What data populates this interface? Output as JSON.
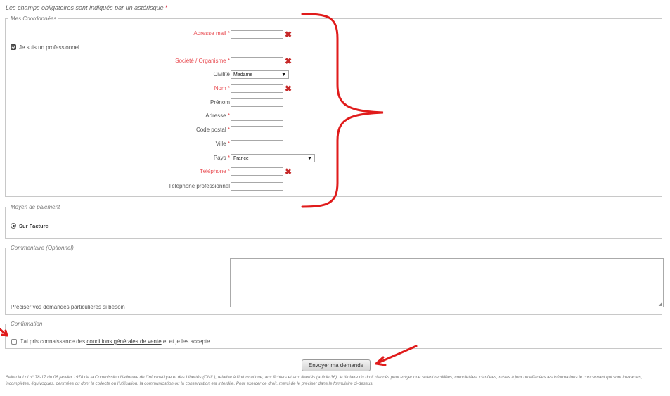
{
  "intro": {
    "text": "Les champs obligatoires sont indiqués par un astérisque",
    "star": "*"
  },
  "coords": {
    "legend": "Mes Coordonnées",
    "pro_checkbox_label": "Je suis un professionnel",
    "pro_checked": true,
    "email_label": "Adresse mail",
    "company_label": "Société / Organisme",
    "civility_label": "Civilité",
    "civility_value": "Madame",
    "lastname_label": "Nom",
    "firstname_label": "Prénom",
    "address_label": "Adresse",
    "zip_label": "Code postal",
    "city_label": "Ville",
    "country_label": "Pays",
    "country_value": "France",
    "phone_label": "Téléphone",
    "phone_pro_label": "Téléphone professionnel",
    "star": "*"
  },
  "payment": {
    "legend": "Moyen de paiement",
    "option": "Sur Facture"
  },
  "comment": {
    "legend": "Commentaire (Optionnel)",
    "hint": "Préciser vos demandes particulières si besoin"
  },
  "confirm": {
    "legend": "Confirmation",
    "text_before": "J'ai pris connaissance des",
    "link": "conditions générales de vente",
    "text_after": "et et je les accepte"
  },
  "submit_label": "Envoyer ma demande",
  "legal_text": "Selon la Loi n° 78-17 du 06 janvier 1978 de la Commission Nationale de l'Informatique et des Libertés (CNIL), relative à l'informatique, aux fichiers et aux libertés (article 36), le titulaire du droit d'accès peut exiger que soient rectifiées, complétées, clarifiées, mises à jour ou effacées les informations le concernant qui sont inexactes, incomplètes, équivoques, périmées ou dont la collecte ou l'utilisation, la communication ou la conservation est interdite. Pour exercer ce droit, merci de le préciser dans le formulaire ci-dessus.",
  "colors": {
    "required": "#e8484e",
    "error_icon": "#c62828",
    "annotation": "#e01b1b"
  },
  "icons": {
    "error": "x-mark-icon",
    "dropdown": "chevron-down-icon"
  }
}
